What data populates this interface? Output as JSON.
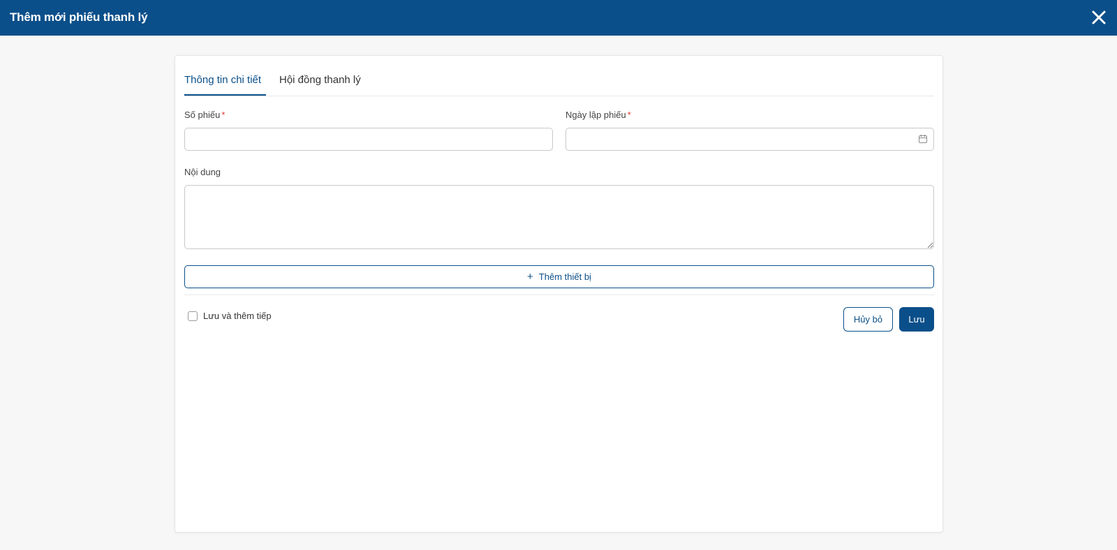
{
  "header": {
    "title": "Thêm mới phiếu thanh lý",
    "close_icon": "close-icon"
  },
  "tabs": [
    {
      "label": "Thông tin chi tiết",
      "active": true
    },
    {
      "label": "Hội đồng thanh lý",
      "active": false
    }
  ],
  "form": {
    "so_phieu": {
      "label": "Số phiếu",
      "required_mark": "*",
      "value": "",
      "placeholder": ""
    },
    "ngay_lap_phieu": {
      "label": "Ngày lập phiếu",
      "required_mark": "*",
      "value": "",
      "placeholder": "",
      "icon": "calendar-icon"
    },
    "noi_dung": {
      "label": "Nội dung",
      "value": "",
      "placeholder": ""
    }
  },
  "add_device_button": {
    "icon": "plus-icon",
    "label": "Thêm thiết bị"
  },
  "footer": {
    "save_and_continue": {
      "label": "Lưu và thêm tiếp",
      "checked": false
    },
    "cancel_label": "Hủy bỏ",
    "save_label": "Lưu"
  },
  "colors": {
    "primary": "#0b4f8a",
    "required": "#e53935",
    "background": "#f7f7f7"
  }
}
